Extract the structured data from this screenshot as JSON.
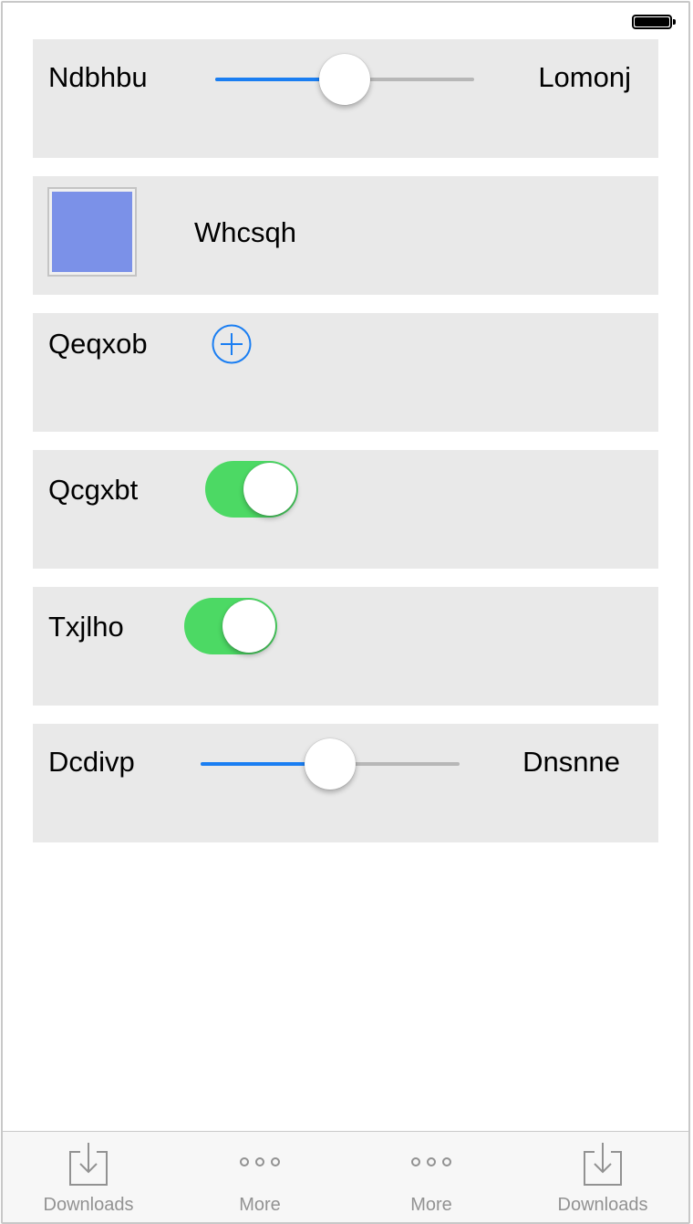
{
  "status_bar": {
    "battery_icon": "battery-full-icon"
  },
  "rows": [
    {
      "type": "slider",
      "label": "Ndbhbu",
      "value_label": "Lomonj",
      "slider_value": 0.5
    },
    {
      "type": "color",
      "label": "Whcsqh",
      "swatch_color": "#7b91e8"
    },
    {
      "type": "add",
      "label": "Qeqxob",
      "icon": "plus-circle-icon"
    },
    {
      "type": "switch",
      "label": "Qcgxbt",
      "on": true
    },
    {
      "type": "switch",
      "label": "Txjlho",
      "on": true
    },
    {
      "type": "slider",
      "label": "Dcdivp",
      "value_label": "Dnsnne",
      "slider_value": 0.5
    }
  ],
  "tabbar": {
    "tabs": [
      {
        "label": "Downloads",
        "icon": "download-icon"
      },
      {
        "label": "More",
        "icon": "more-icon"
      },
      {
        "label": "More",
        "icon": "more-icon"
      },
      {
        "label": "Downloads",
        "icon": "download-icon"
      }
    ]
  },
  "colors": {
    "accent": "#1a7ef2",
    "switch_on": "#4cd964",
    "cell_background": "#e9e9e9",
    "tab_inactive": "#929292"
  }
}
